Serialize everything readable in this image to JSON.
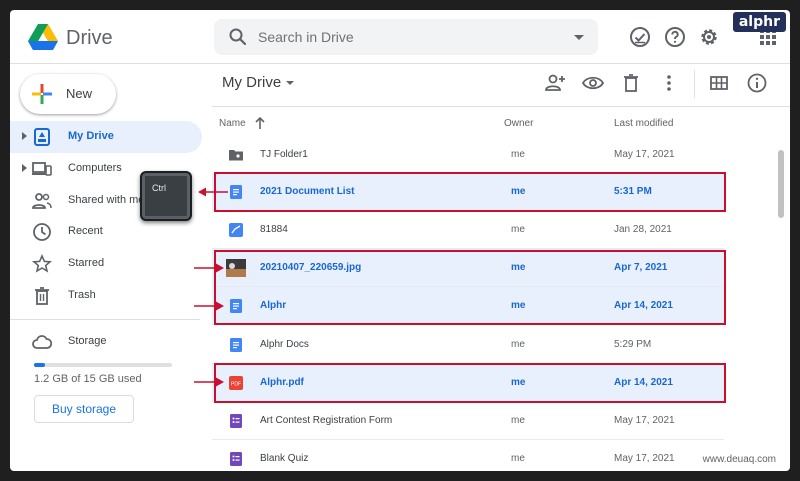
{
  "brand": "alphr",
  "header": {
    "app_title": "Drive",
    "search_placeholder": "Search in Drive"
  },
  "sidebar": {
    "new_label": "New",
    "items": [
      {
        "label": "My Drive",
        "icon": "my-drive-icon",
        "active": true
      },
      {
        "label": "Computers",
        "icon": "computers-icon"
      },
      {
        "label": "Shared with me",
        "icon": "shared-icon"
      },
      {
        "label": "Recent",
        "icon": "clock-icon"
      },
      {
        "label": "Starred",
        "icon": "star-icon"
      },
      {
        "label": "Trash",
        "icon": "trash-icon"
      }
    ],
    "storage": {
      "label": "Storage",
      "used_fraction": 0.08,
      "usage_text": "1.2 GB of 15 GB used",
      "buy_label": "Buy storage"
    }
  },
  "main": {
    "title": "My Drive",
    "columns": {
      "name": "Name",
      "owner": "Owner",
      "modified": "Last modified"
    },
    "files": [
      {
        "name": "TJ Folder1",
        "owner": "me",
        "modified": "May 17, 2021",
        "type": "folder",
        "selected": false
      },
      {
        "name": "2021 Document List",
        "owner": "me",
        "modified": "5:31 PM",
        "type": "doc",
        "selected": true
      },
      {
        "name": "81884",
        "owner": "me",
        "modified": "Jan 28, 2021",
        "type": "image",
        "selected": false
      },
      {
        "name": "20210407_220659.jpg",
        "owner": "me",
        "modified": "Apr 7, 2021",
        "type": "photo",
        "selected": true
      },
      {
        "name": "Alphr",
        "owner": "me",
        "modified": "Apr 14, 2021",
        "type": "doc",
        "selected": true
      },
      {
        "name": "Alphr Docs",
        "owner": "me",
        "modified": "5:29 PM",
        "type": "doc",
        "selected": false
      },
      {
        "name": "Alphr.pdf",
        "owner": "me",
        "modified": "Apr 14, 2021",
        "type": "pdf",
        "selected": true
      },
      {
        "name": "Art Contest Registration Form",
        "owner": "me",
        "modified": "May 17, 2021",
        "type": "form",
        "selected": false
      },
      {
        "name": "Blank Quiz",
        "owner": "me",
        "modified": "May 17, 2021",
        "type": "form",
        "selected": false
      }
    ]
  },
  "overlay": {
    "key_label": "Ctrl",
    "highlight_color": "#c8102e"
  },
  "watermark": "www.deuaq.com"
}
